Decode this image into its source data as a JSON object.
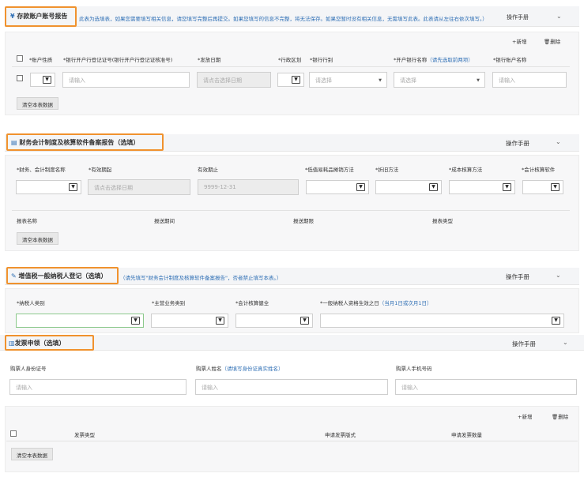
{
  "sections": {
    "deposit": {
      "title": "存款账户账号报告",
      "hint": "此表为选填表，如果您需要填写相关信息，请您填写完整后再提交。如果您填写的信息不完整，将无法保存。如果您暂时没有相关信息，无需填写此表。此表请从左往右依次填写。）",
      "manual": "操作手册",
      "add": "新增",
      "delete": "删除",
      "columns": [
        "*账户性质",
        "*银行开户行登记证号(银行开户行登记证核准号)",
        "*发放日期",
        "*行政区划",
        "*银行行别",
        "*开户银行名称",
        "（请先选取前两项）",
        "*银行账户名称"
      ],
      "placeholders": {
        "input": "请输入",
        "date": "请点击选择日期",
        "select": "请选择",
        "select2": "请选择"
      },
      "clear": "清空本表数据"
    },
    "accounting": {
      "title": "财务会计制度及核算软件备案报告（选填）",
      "manual": "操作手册",
      "columns": [
        "*财务、会计制度名称",
        "*有效期起",
        "有效期止",
        "*低值易耗品摊销方法",
        "*折旧方法",
        "*成本核算方法",
        "*会计核算软件"
      ],
      "date_placeholder": "请点击选择日期",
      "end_date": "9999-12-31",
      "report_columns": [
        "报表名称",
        "报送期间",
        "报送期限",
        "报表类型"
      ],
      "clear": "清空本表数据"
    },
    "vat": {
      "title": "增值税一般纳税人登记（选填）",
      "hint": "（请先填写\"财务会计制度及核算软件备案报告\"，否者禁止填写本表。）",
      "manual": "操作手册",
      "columns": [
        "*纳税人类别",
        "*主营业务类别",
        "*会计核算健全",
        "*一般纳税人资格生效之日"
      ],
      "col4_hint": "（当月1日或次月1日）"
    },
    "invoice": {
      "title": "发票申领（选填）",
      "manual": "操作手册",
      "fields": [
        "购票人身份证号",
        "购票人姓名",
        "（请填写身份证真实姓名）",
        "购票人手机号码"
      ],
      "placeholder": "请输入",
      "add": "新增",
      "delete": "删除",
      "table_columns": [
        "发票类型",
        "申请发票版式",
        "申请发票数量"
      ],
      "clear": "清空本表数据"
    }
  },
  "icons": {
    "chevron": "chevron-down-icon",
    "add": "plus-icon",
    "delete": "trash-icon"
  }
}
